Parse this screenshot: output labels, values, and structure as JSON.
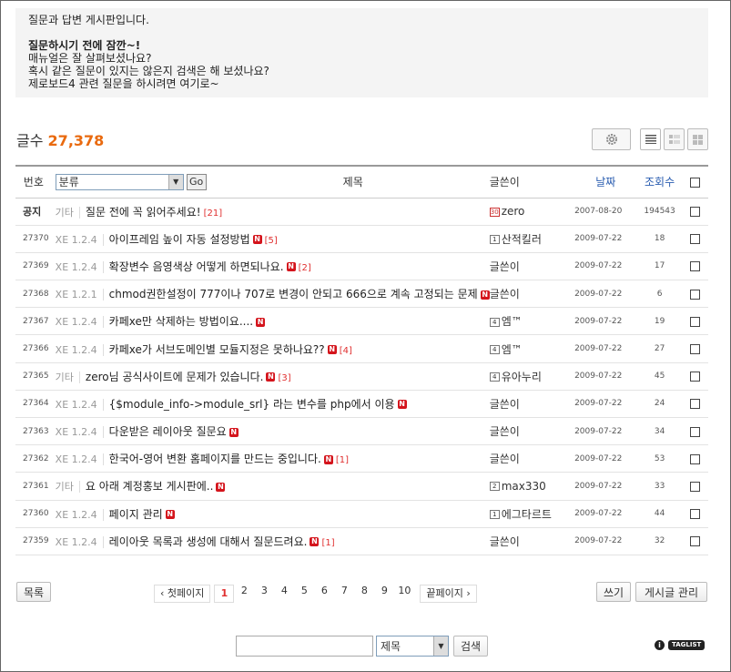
{
  "notice": {
    "line1": "질문과 답변 게시판입니다.",
    "heading": "질문하시기 전에 잠깐~!",
    "line2": "매뉴얼은 잘 살펴보셨나요?",
    "line3": "혹시 같은 질문이 있지는 않은지 검색은 해 보셨나요?",
    "line4": "제로보드4 관련 질문을 하시려면 여기로~"
  },
  "count": {
    "label": "글수",
    "value": "27,378"
  },
  "table": {
    "headers": {
      "no": "번호",
      "category": "분류",
      "go": "Go",
      "title": "제목",
      "author": "글쓴이",
      "date": "날짜",
      "views": "조회수"
    },
    "rows": [
      {
        "no": "공지",
        "cat": "기타",
        "title": "질문 전에 꼭 읽어주세요!",
        "new": false,
        "comments": "[21]",
        "level": "30",
        "author": "zero",
        "date": "2007-08-20",
        "views": "194543"
      },
      {
        "no": "27370",
        "cat": "XE 1.2.4",
        "title": "아이프레임 높이 자동 설정방법",
        "new": true,
        "comments": "[5]",
        "level": "1",
        "author": "산적킬러",
        "date": "2009-07-22",
        "views": "18"
      },
      {
        "no": "27369",
        "cat": "XE 1.2.4",
        "title": "확장변수 음영색상 어떻게 하면되나요.",
        "new": true,
        "comments": "[2]",
        "level": "",
        "author": "글쓴이",
        "date": "2009-07-22",
        "views": "17"
      },
      {
        "no": "27368",
        "cat": "XE 1.2.1",
        "title": "chmod권한설정이 777이나 707로 변경이 안되고 666으로 계속 고정되는 문제",
        "new": true,
        "comments": "",
        "level": "",
        "author": "글쓴이",
        "date": "2009-07-22",
        "views": "6"
      },
      {
        "no": "27367",
        "cat": "XE 1.2.4",
        "title": "카페xe만 삭제하는 방법이요....",
        "new": true,
        "comments": "",
        "level": "4",
        "author": "엠™",
        "date": "2009-07-22",
        "views": "19"
      },
      {
        "no": "27366",
        "cat": "XE 1.2.4",
        "title": "카페xe가 서브도메인별 모듈지정은 못하나요??",
        "new": true,
        "comments": "[4]",
        "level": "4",
        "author": "엠™",
        "date": "2009-07-22",
        "views": "27"
      },
      {
        "no": "27365",
        "cat": "기타",
        "title": "zero님 공식사이트에 문제가 있습니다.",
        "new": true,
        "comments": "[3]",
        "level": "4",
        "author": "유아누리",
        "date": "2009-07-22",
        "views": "45"
      },
      {
        "no": "27364",
        "cat": "XE 1.2.4",
        "title": "{$module_info->module_srl} 라는 변수를 php에서 이용",
        "new": true,
        "comments": "",
        "level": "",
        "author": "글쓴이",
        "date": "2009-07-22",
        "views": "24"
      },
      {
        "no": "27363",
        "cat": "XE 1.2.4",
        "title": "다운받은 레이아웃 질문요",
        "new": true,
        "comments": "",
        "level": "",
        "author": "글쓴이",
        "date": "2009-07-22",
        "views": "34"
      },
      {
        "no": "27362",
        "cat": "XE 1.2.4",
        "title": "한국어-영어 변환 홈페이지를 만드는 중입니다.",
        "new": true,
        "comments": "[1]",
        "level": "",
        "author": "글쓴이",
        "date": "2009-07-22",
        "views": "53"
      },
      {
        "no": "27361",
        "cat": "기타",
        "title": "요 아래 계정홍보 게시판에..",
        "new": true,
        "comments": "",
        "level": "2",
        "author": "max330",
        "date": "2009-07-22",
        "views": "33"
      },
      {
        "no": "27360",
        "cat": "XE 1.2.4",
        "title": "페이지 관리",
        "new": true,
        "comments": "",
        "level": "1",
        "author": "에그타르트",
        "date": "2009-07-22",
        "views": "44"
      },
      {
        "no": "27359",
        "cat": "XE 1.2.4",
        "title": "레이아웃 목록과 생성에 대해서 질문드려요.",
        "new": true,
        "comments": "[1]",
        "level": "",
        "author": "글쓴이",
        "date": "2009-07-22",
        "views": "32"
      }
    ]
  },
  "buttons": {
    "list": "목록",
    "write": "쓰기",
    "manage": "게시글 관리",
    "search": "검색"
  },
  "pager": {
    "first": "첫페이지",
    "last": "끝페이지",
    "pages": [
      "1",
      "2",
      "3",
      "4",
      "5",
      "6",
      "7",
      "8",
      "9",
      "10"
    ],
    "current": "1"
  },
  "search": {
    "field": "제목"
  },
  "badges": {
    "new": "N",
    "taglist": "TAGLIST",
    "info": "i"
  },
  "colors": {
    "accent": "#e96a0f",
    "new_badge": "#d4141c",
    "comment": "#e03030",
    "blue_header": "#2a5db0"
  }
}
